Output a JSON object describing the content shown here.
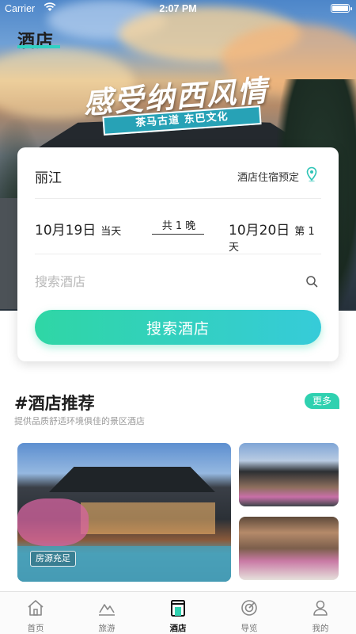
{
  "status_bar": {
    "carrier": "Carrier",
    "time": "2:07 PM"
  },
  "header": {
    "title": "酒店"
  },
  "banner": {
    "slogan": "感受纳西风情",
    "ribbon": "茶马古道  东巴文化"
  },
  "search_card": {
    "city": "丽江",
    "booking_type": "酒店住宿预定",
    "check_in": {
      "date": "10月19日",
      "note": "当天"
    },
    "nights": "共 1 晚",
    "check_out": {
      "date": "10月20日",
      "note": "第 1 天"
    },
    "search_placeholder": "搜索酒店",
    "search_button": "搜索酒店"
  },
  "recommendations": {
    "title": "#酒店推荐",
    "subtitle": "提供品质舒适环境俱佳的景区酒店",
    "more_label": "更多",
    "main_tag": "房源充足"
  },
  "tabbar": {
    "items": [
      {
        "label": "首页",
        "icon": "home-icon"
      },
      {
        "label": "旅游",
        "icon": "mountain-icon"
      },
      {
        "label": "酒店",
        "icon": "hotel-icon",
        "active": true
      },
      {
        "label": "导览",
        "icon": "target-icon"
      },
      {
        "label": "我的",
        "icon": "user-icon"
      }
    ]
  },
  "colors": {
    "accent": "#2fd1b0",
    "button_start": "#2fd6a5",
    "button_end": "#36cbd9"
  }
}
